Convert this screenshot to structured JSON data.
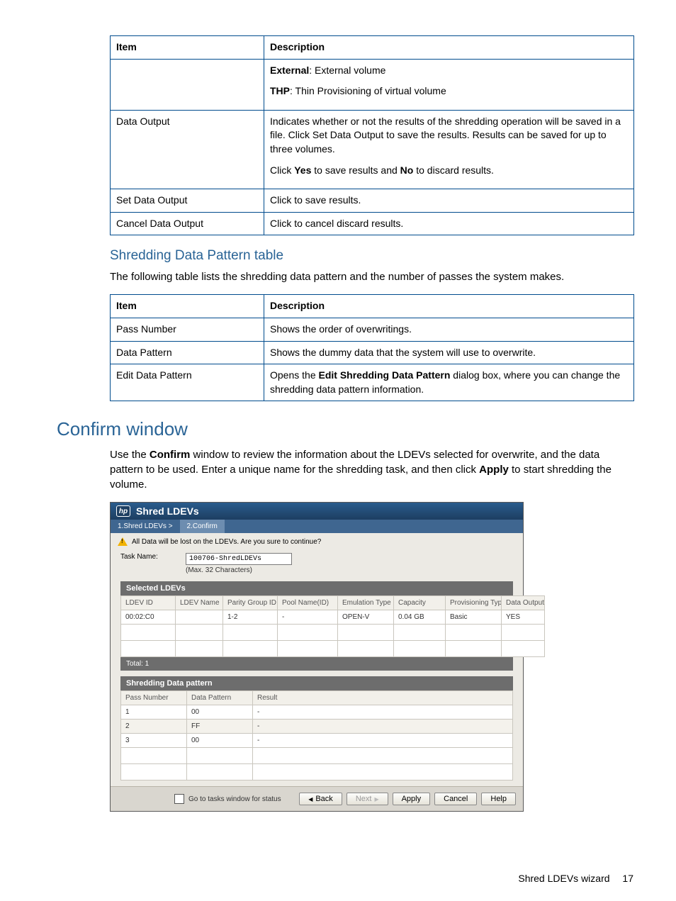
{
  "table1": {
    "headers": {
      "item": "Item",
      "desc": "Description"
    },
    "rows": [
      {
        "item": "",
        "desc_html_parts": {
          "p1_bold": "External",
          "p1_rest": ": External volume",
          "p2_bold": "THP",
          "p2_rest": ": Thin Provisioning of virtual volume"
        }
      },
      {
        "item": "Data Output",
        "desc_line1": "Indicates whether or not the results of the shredding operation will be saved in a file. Click Set Data Output to save the results. Results can be saved for up to three volumes.",
        "desc_line2_pre": "Click ",
        "desc_line2_b1": "Yes",
        "desc_line2_mid": " to save results and ",
        "desc_line2_b2": "No",
        "desc_line2_post": " to discard results."
      },
      {
        "item": "Set Data Output",
        "desc": "Click to save results."
      },
      {
        "item": "Cancel Data Output",
        "desc": "Click to cancel discard results."
      }
    ]
  },
  "sectionShred": {
    "heading": "Shredding Data Pattern table",
    "intro": "The following table lists the shredding data pattern and the number of passes the system makes."
  },
  "table2": {
    "headers": {
      "item": "Item",
      "desc": "Description"
    },
    "rows": [
      {
        "item": "Pass Number",
        "desc": "Shows the order of overwritings."
      },
      {
        "item": "Data Pattern",
        "desc": "Shows the dummy data that the system will use to overwrite."
      },
      {
        "item": "Edit Data Pattern",
        "desc_pre": "Opens the ",
        "desc_bold": "Edit Shredding Data Pattern",
        "desc_post": " dialog box, where you can change the shredding data pattern information."
      }
    ]
  },
  "confirm": {
    "heading": "Confirm window",
    "intro_pre": "Use the ",
    "intro_b1": "Confirm",
    "intro_mid": " window to review the information about the LDEVs selected for overwrite, and the data pattern to be used. Enter a unique name for the shredding task, and then click ",
    "intro_b2": "Apply",
    "intro_post": " to start shredding the volume."
  },
  "dlg": {
    "title": "Shred LDEVs",
    "bc1": "1.Shred LDEVs >",
    "bc2": "2.Confirm",
    "warn": "All Data will be lost on the LDEVs. Are you sure to continue?",
    "taskLabel": "Task Name:",
    "taskValue": "100706-ShredLDEVs",
    "maxHint": "(Max. 32 Characters)",
    "selectedHd": "Selected LDEVs",
    "cols": {
      "ldevId": "LDEV ID",
      "ldevName": "LDEV Name",
      "parity": "Parity Group ID",
      "pool": "Pool Name(ID)",
      "emu": "Emulation Type",
      "cap": "Capacity",
      "prov": "Provisioning Type",
      "out": "Data Output"
    },
    "row1": {
      "ldevId": "00:02:C0",
      "ldevName": "",
      "parity": "1-2",
      "pool": "-",
      "emu": "OPEN-V",
      "cap": "0.04 GB",
      "prov": "Basic",
      "out": "YES"
    },
    "totals": "Total: 1",
    "sdpHd": "Shredding Data pattern",
    "sdpCols": {
      "pass": "Pass Number",
      "pattern": "Data Pattern",
      "result": "Result"
    },
    "sdpRows": [
      {
        "pass": "1",
        "pattern": "00",
        "result": "-"
      },
      {
        "pass": "2",
        "pattern": "FF",
        "result": "-"
      },
      {
        "pass": "3",
        "pattern": "00",
        "result": "-"
      }
    ],
    "footer": {
      "chkLabel": "Go to tasks window for status",
      "back": "Back",
      "next": "Next",
      "apply": "Apply",
      "cancel": "Cancel",
      "help": "Help"
    }
  },
  "footer": {
    "text": "Shred LDEVs wizard",
    "page": "17"
  }
}
